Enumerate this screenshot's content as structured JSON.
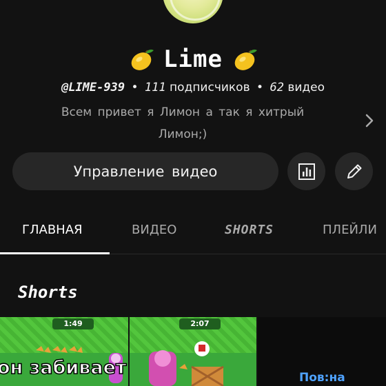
{
  "channel": {
    "title": "Lime",
    "handle": "@LIME-939",
    "subscribers_count": "111",
    "subscribers_label": "подписчиков",
    "videos_count": "62",
    "videos_label": "видео",
    "description_line1": "Всем привет я Лимон а так я  хитрый",
    "description_line2": "Лимон;)",
    "separator": "•"
  },
  "actions": {
    "manage_label": "Управление видео"
  },
  "tabs": [
    {
      "label": "ГЛАВНАЯ",
      "active": true
    },
    {
      "label": "ВИДЕО",
      "active": false
    },
    {
      "label": "SHORTS",
      "active": false
    },
    {
      "label": "ПЛЕЙЛИ",
      "active": false
    }
  ],
  "section": {
    "title": "Shorts"
  },
  "shorts": [
    {
      "timer": "1:49",
      "overlay": "он забивает"
    },
    {
      "timer": "2:07",
      "overlay": ""
    },
    {
      "timer": "",
      "overlay": "Пов:на"
    }
  ],
  "colors": {
    "background": "#121212",
    "button_bg": "#272727",
    "secondary_text": "#aaaaaa",
    "lemon": "#f4c21f"
  }
}
